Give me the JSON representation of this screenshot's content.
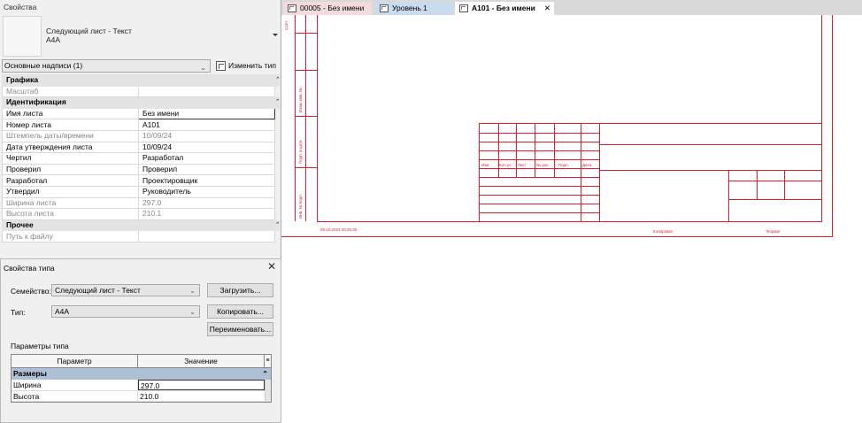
{
  "properties": {
    "title": "Свойства",
    "family_line1": "Следующий лист - Текст",
    "family_line2": "A4A",
    "selector": "Основные надписи (1)",
    "edit_type": "Изменить тип",
    "groups": [
      {
        "name": "Графика",
        "rows": [
          {
            "label": "Масштаб",
            "value": "",
            "readonly": true
          }
        ]
      },
      {
        "name": "Идентификация",
        "rows": [
          {
            "label": "Имя листа",
            "value": "Без имени",
            "readonly": false
          },
          {
            "label": "Номер листа",
            "value": "A101",
            "readonly": false
          },
          {
            "label": "Штемпель даты/времени",
            "value": "10/09/24",
            "readonly": true
          },
          {
            "label": "Дата утверждения листа",
            "value": "10/09/24",
            "readonly": false
          },
          {
            "label": "Чертил",
            "value": "Разработал",
            "readonly": false
          },
          {
            "label": "Проверил",
            "value": "Проверил",
            "readonly": false
          },
          {
            "label": "Разработал",
            "value": "Проектировщик",
            "readonly": false
          },
          {
            "label": "Утвердил",
            "value": "Руководитель",
            "readonly": false
          },
          {
            "label": "Ширина листа",
            "value": "297.0",
            "readonly": true
          },
          {
            "label": "Высота листа",
            "value": "210.1",
            "readonly": true
          }
        ]
      },
      {
        "name": "Прочее",
        "rows": [
          {
            "label": "Путь к файлу",
            "value": "",
            "readonly": true
          }
        ]
      }
    ]
  },
  "type_dialog": {
    "title": "Свойства типа",
    "family_label": "Семейство:",
    "family_value": "Следующий лист - Текст",
    "type_label": "Тип:",
    "type_value": "A4A",
    "load_button": "Загрузить...",
    "copy_button": "Копировать...",
    "rename_button": "Переименовать...",
    "params_label": "Параметры типа",
    "col_param": "Параметр",
    "col_value": "Значение",
    "group": "Размеры",
    "rows": [
      {
        "label": "Ширина",
        "value": "297.0"
      },
      {
        "label": "Высота",
        "value": "210.0"
      }
    ]
  },
  "tabs": [
    {
      "label": "00005 - Без имени",
      "active": false
    },
    {
      "label": "Уровень 1",
      "active": false
    },
    {
      "label": "A101 - Без имени",
      "active": true
    }
  ],
  "drawing": {
    "side_labels": [
      "Согл.",
      "Взам. инв. №",
      "Подп. и дата",
      "Инв. № подл."
    ],
    "stamp_headers": [
      "Изм.",
      "Кол.уч",
      "Лист",
      "№ док.",
      "Подп.",
      "Дата"
    ],
    "timestamp": "09.10.2024 20:25:30",
    "copied": "Копировал",
    "format": "Формат"
  },
  "colors": {
    "drawing_red": "#e11d2a",
    "active_tab": "#c9dcef",
    "dialog_group": "#aebfd6"
  }
}
